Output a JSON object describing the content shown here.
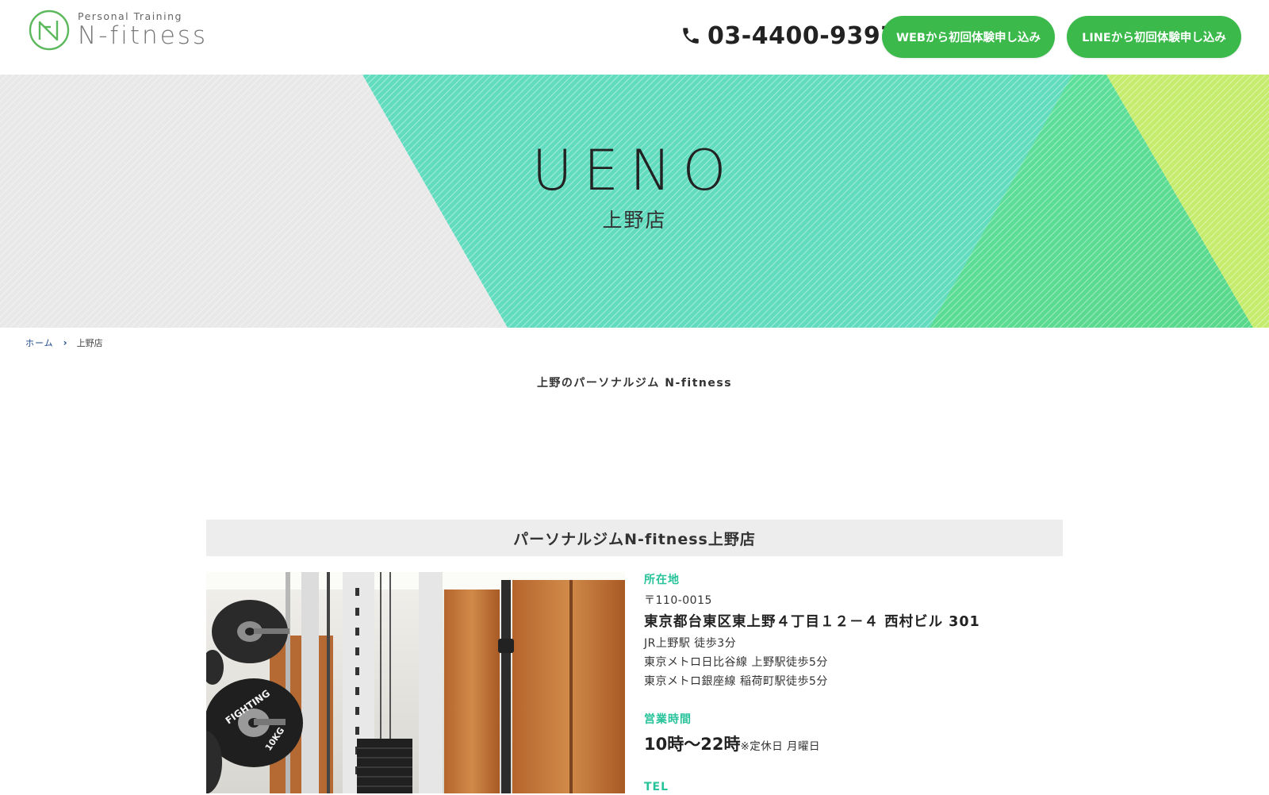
{
  "header": {
    "logo_sub": "Personal Training",
    "logo_main": "N-fitness",
    "phone_number": "03-4400-9397",
    "web_button_label": "WEBから初回体験申し込み",
    "line_button_label": "LINEから初回体験申し込み"
  },
  "hero": {
    "title": "UENO",
    "subtitle": "上野店"
  },
  "breadcrumb": {
    "home": "ホーム",
    "current": "上野店"
  },
  "intro": {
    "heading": "上野のパーソナルジム N-fitness"
  },
  "store": {
    "name": "パーソナルジムN-fitness上野店",
    "location_label": "所在地",
    "postal_code": "〒110-0015",
    "address": "東京都台東区東上野４丁目１２－４ 西村ビル 301",
    "access": [
      "JR上野駅 徒歩3分",
      "東京メトロ日比谷線 上野駅徒歩5分",
      "東京メトロ銀座線 稲荷町駅徒歩5分"
    ],
    "hours_label": "営業時間",
    "hours": "10時〜22時",
    "hours_note": "※定休日 月曜日",
    "tel_label": "TEL"
  },
  "colors": {
    "brand_green": "#3bba4b",
    "accent_teal": "#27c39a",
    "hero_teal": "#5fdcbd",
    "hero_green": "#5fdf8f",
    "hero_yellow": "#c8ec6a"
  },
  "icons": {
    "logo": "n-fitness-logo-mark",
    "phone": "phone-icon",
    "breadcrumb_separator": "chevron-right-icon"
  }
}
